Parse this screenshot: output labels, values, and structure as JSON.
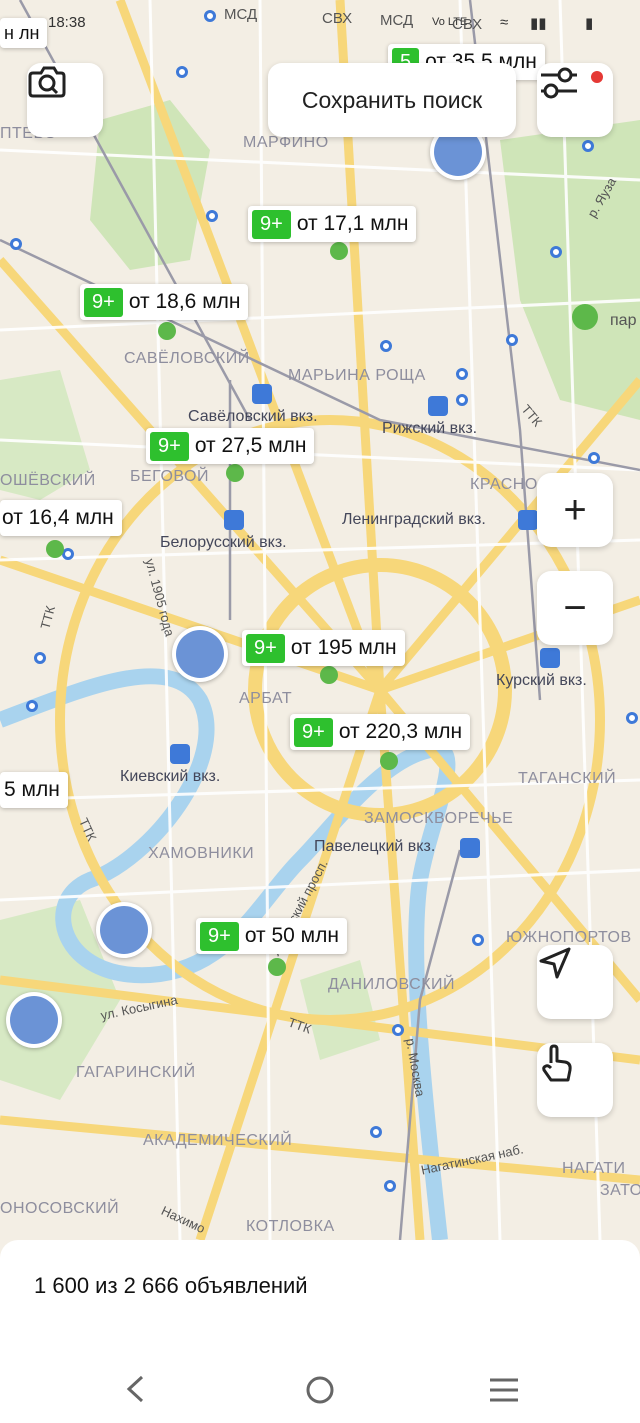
{
  "status_bar": {
    "time": "18:38",
    "indicators": "Vo LTE"
  },
  "toolbar": {
    "save_search_label": "Сохранить поиск"
  },
  "map": {
    "district_labels": [
      "МАРФИНО",
      "САВЁЛОВСКИЙ",
      "МАРЬИНА РОЩА",
      "БЕГОВОЙ",
      "ОШЁВСКИЙ",
      "КРАСНО",
      "АРБАТ",
      "ХАМОВНИКИ",
      "ЗАМОСКВОРЕЧЬЕ",
      "ТАГАНСКИЙ",
      "ЮЖНОПОРТОВ",
      "ДАНИЛОВСКИЙ",
      "ГАГАРИНСКИЙ",
      "АКАДЕМИЧЕСКИЙ",
      "ОНОСОВСКИЙ",
      "КОТЛОВКА",
      "НАГАТИ",
      "ЗАТО",
      "ПТЕВО"
    ],
    "station_labels": [
      "Савёловский вкз.",
      "Рижский вкз.",
      "Ленинградский вкз.",
      "Белорусский вкз.",
      "Курский вкз.",
      "Киевский вкз.",
      "Павелецкий вкз."
    ],
    "street_labels": [
      "ул. 1905 года",
      "ТТК",
      "ТТК",
      "ТТК",
      "ТТК",
      "ул. Косыгина",
      "Ленинский просп.",
      "р. Москва",
      "Нагатинская наб.",
      "Нахимо",
      "р. Яуза",
      "МСД",
      "СВХ",
      "МСД",
      "СВХ",
      "пар"
    ],
    "markers": [
      {
        "badge": "5",
        "price": "от 35,5 млн"
      },
      {
        "badge": "9+",
        "price": "от 17,1 млн"
      },
      {
        "badge": "9+",
        "price": "от 18,6 млн"
      },
      {
        "badge": "9+",
        "price": "от 27,5 млн"
      },
      {
        "badge": "",
        "price": "от 16,4 млн"
      },
      {
        "badge": "9+",
        "price": "от 195 млн"
      },
      {
        "badge": "9+",
        "price": "от 220,3 млн"
      },
      {
        "badge": "",
        "price": "5 млн"
      },
      {
        "badge": "9+",
        "price": "от 50 млн"
      },
      {
        "badge": "",
        "price": "н лн"
      }
    ],
    "zoom_in": "+",
    "zoom_out": "−",
    "colors": {
      "badge_green": "#2ec02e",
      "metro_blue": "#3e79d8",
      "park_green": "#cfe5b8",
      "river_blue": "#a9d3ee",
      "road_yellow": "#f7d77a"
    }
  },
  "results": {
    "count_text": "1 600 из 2 666 объявлений"
  }
}
